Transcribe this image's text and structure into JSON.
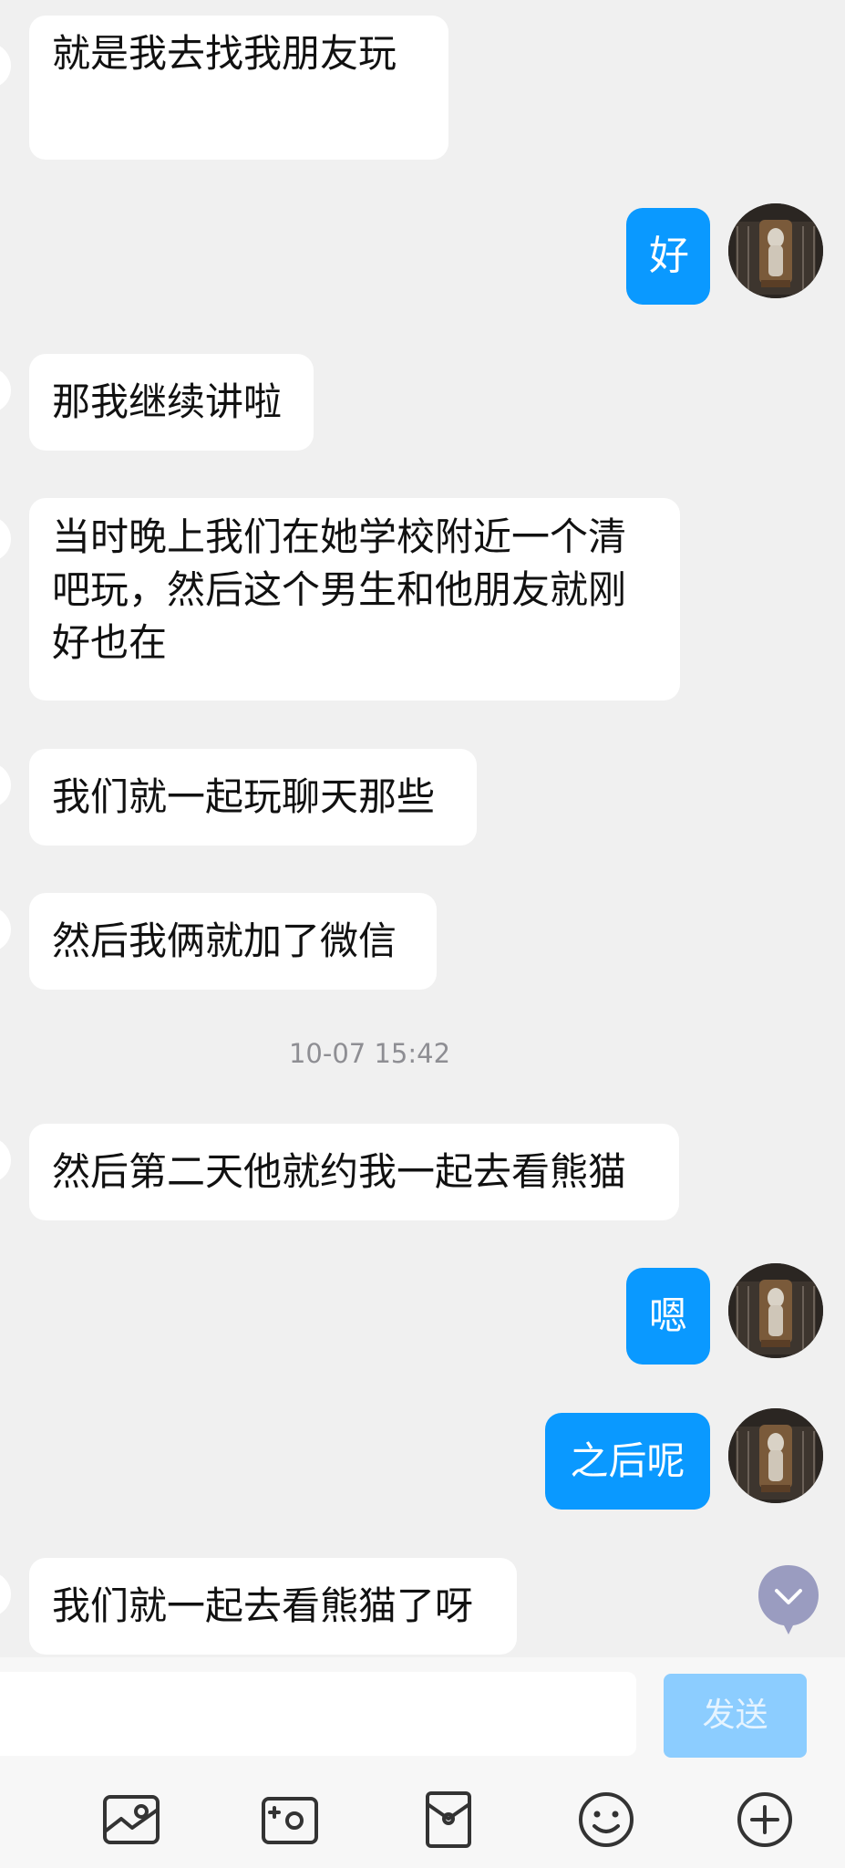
{
  "messages": [
    {
      "side": "incoming",
      "text": "就是我去找我朋友玩"
    },
    {
      "side": "outgoing",
      "text": "好"
    },
    {
      "side": "incoming",
      "text": "那我继续讲啦"
    },
    {
      "side": "incoming",
      "text": "当时晚上我们在她学校附近一个清吧玩，然后这个男生和他朋友就刚好也在"
    },
    {
      "side": "incoming",
      "text": "我们就一起玩聊天那些"
    },
    {
      "side": "incoming",
      "text": "然后我俩就加了微信"
    },
    {
      "side": "incoming",
      "text": "然后第二天他就约我一起去看熊猫"
    },
    {
      "side": "outgoing",
      "text": "嗯"
    },
    {
      "side": "outgoing",
      "text": "之后呢"
    },
    {
      "side": "incoming",
      "text": "我们就一起去看熊猫了呀"
    }
  ],
  "timestamp": "10-07 15:42",
  "input": {
    "value": "",
    "placeholder": ""
  },
  "send_label": "发送",
  "toolbar": [
    "image-icon",
    "camera-icon",
    "red-packet-icon",
    "emoji-icon",
    "plus-icon"
  ],
  "colors": {
    "background": "#f0f0f0",
    "incoming_bubble": "#ffffff",
    "outgoing_bubble": "#0a99ff",
    "send_button": "#8ccdff"
  }
}
